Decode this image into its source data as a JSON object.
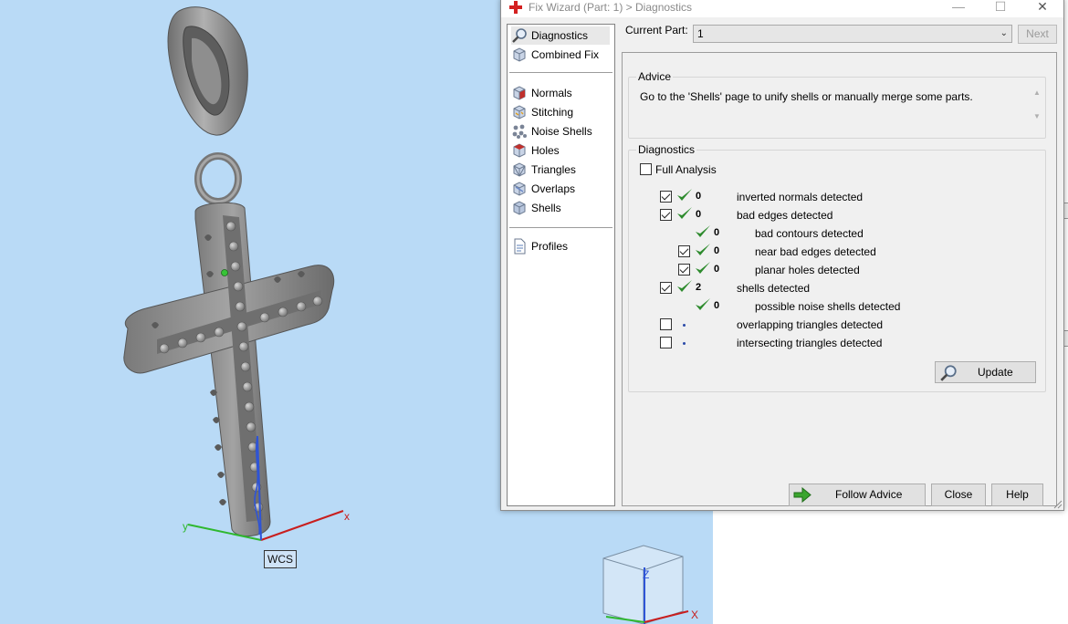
{
  "viewport": {
    "wcs_label": "WCS",
    "axis_x": "x",
    "axis_y": "y",
    "navcube_z": "Z",
    "navcube_x": "X"
  },
  "dialog": {
    "title": "Fix Wizard (Part: 1) > Diagnostics",
    "window_buttons": {
      "minimize": "—",
      "maximize": "☐",
      "close": "✕"
    },
    "current_part_label": "Current Part:",
    "current_part_value": "1",
    "next_label": "Next",
    "nav": {
      "items": [
        {
          "label": "Diagnostics",
          "icon": "magnifier-icon",
          "selected": true
        },
        {
          "label": "Combined Fix",
          "icon": "cube-icon"
        },
        {
          "label": "Normals",
          "icon": "normals-cube-icon"
        },
        {
          "label": "Stitching",
          "icon": "stitching-cube-icon"
        },
        {
          "label": "Noise Shells",
          "icon": "noise-shells-icon"
        },
        {
          "label": "Holes",
          "icon": "holes-cube-icon"
        },
        {
          "label": "Triangles",
          "icon": "triangles-cube-icon"
        },
        {
          "label": "Overlaps",
          "icon": "overlaps-cube-icon"
        },
        {
          "label": "Shells",
          "icon": "shells-cube-icon"
        },
        {
          "label": "Profiles",
          "icon": "document-icon"
        }
      ]
    },
    "advice": {
      "group_title": "Advice",
      "text": "Go to the 'Shells' page to unify shells or manually merge some parts."
    },
    "diagnostics": {
      "group_title": "Diagnostics",
      "full_analysis_label": "Full Analysis",
      "rows": [
        {
          "checked": true,
          "status": "ok",
          "count": "0",
          "label": "inverted normals detected",
          "indent": 0
        },
        {
          "checked": true,
          "status": "ok",
          "count": "0",
          "label": "bad edges detected",
          "indent": 0
        },
        {
          "checked": null,
          "status": "ok",
          "count": "0",
          "label": "bad contours detected",
          "indent": 1
        },
        {
          "checked": true,
          "status": "ok",
          "count": "0",
          "label": "near bad edges detected",
          "indent": 1
        },
        {
          "checked": true,
          "status": "ok",
          "count": "0",
          "label": "planar holes detected",
          "indent": 1
        },
        {
          "checked": true,
          "status": "ok",
          "count": "2",
          "label": "shells detected",
          "indent": 0
        },
        {
          "checked": null,
          "status": "ok",
          "count": "0",
          "label": "possible noise shells detected",
          "indent": 1
        },
        {
          "checked": false,
          "status": "unknown",
          "count": "",
          "label": "overlapping triangles detected",
          "indent": 0
        },
        {
          "checked": false,
          "status": "unknown",
          "count": "",
          "label": "intersecting triangles detected",
          "indent": 0
        }
      ],
      "update_label": "Update"
    },
    "footer": {
      "follow_advice_label": "Follow Advice",
      "close_label": "Close",
      "help_label": "Help"
    },
    "colors": {
      "tick_green": "#2e8b2e",
      "arrow_green": "#3aa52e",
      "title_icon_red": "#d42020",
      "viewport_bg": "#b9daf6"
    }
  }
}
